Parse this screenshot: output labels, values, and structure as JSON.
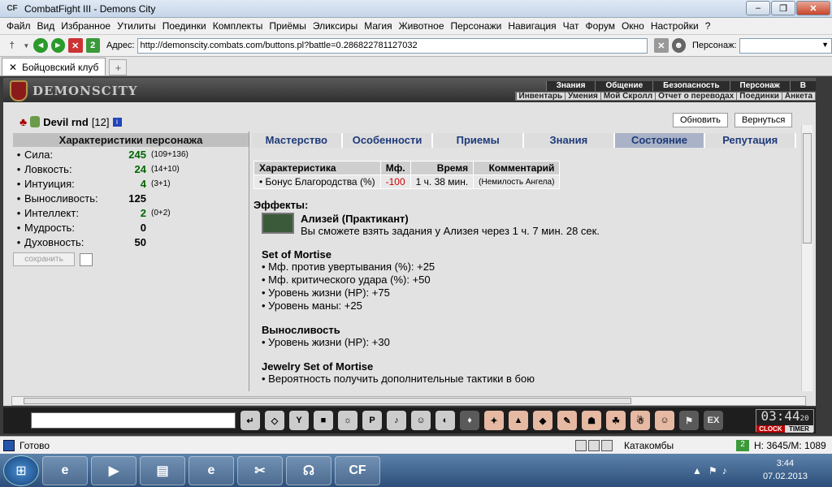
{
  "window": {
    "title": "CombatFight III - Demons City",
    "app_icon": "CF"
  },
  "menu": [
    "Файл",
    "Вид",
    "Избранное",
    "Утилиты",
    "Поединки",
    "Комплекты",
    "Приёмы",
    "Эликсиры",
    "Магия",
    "Животное",
    "Персонажи",
    "Навигация",
    "Чат",
    "Форум",
    "Окно",
    "Настройки",
    "?"
  ],
  "address": {
    "label": "Адрес:",
    "url": "http://demonscity.combats.com/buttons.pl?battle=0.286822781127032",
    "person_label": "Персонаж:"
  },
  "browser_tab": {
    "label": "Бойцовский клуб",
    "add": "+"
  },
  "game": {
    "logo": "DEMONSCITY",
    "top_nav": [
      "Знания",
      "Общение",
      "Безопасность",
      "Персонаж",
      "В"
    ],
    "sub_nav": [
      "Инвентарь",
      "Умения",
      "Мой Скролл",
      "Отчет о переводах",
      "Поединки",
      "Анкета"
    ],
    "character": {
      "name": "Devil rnd",
      "level": "[12]",
      "info": "i"
    },
    "buttons": {
      "refresh": "Обновить",
      "back": "Вернуться"
    },
    "stats_title": "Характеристики персонажа",
    "stats": [
      {
        "name": "Сила:",
        "value": "245",
        "extra": "(109+136)"
      },
      {
        "name": "Ловкость:",
        "value": "24",
        "extra": "(14+10)"
      },
      {
        "name": "Интуиция:",
        "value": "4",
        "extra": "(3+1)"
      },
      {
        "name": "Выносливость:",
        "value": "125",
        "extra": ""
      },
      {
        "name": "Интеллект:",
        "value": "2",
        "extra": "(0+2)"
      },
      {
        "name": "Мудрость:",
        "value": "0",
        "extra": ""
      },
      {
        "name": "Духовность:",
        "value": "50",
        "extra": ""
      }
    ],
    "save_label": "сохранить",
    "tabs": [
      "Мастерство",
      "Особенности",
      "Приемы",
      "Знания",
      "Состояние",
      "Репутация"
    ],
    "table": {
      "headers": [
        "Характеристика",
        "Мф.",
        "Время",
        "Комментарий"
      ],
      "row": [
        "• Бонус Благородства (%)",
        "-100",
        "1 ч. 38 мин.",
        "(Немилость Ангела)"
      ]
    },
    "effects_title": "Эффекты:",
    "alizey": {
      "title": "Ализей (Практикант)",
      "text": "Вы сможете взять задания у Ализея через 1 ч. 7 мин. 28 сек."
    },
    "sets": [
      {
        "title": "Set of Mortise",
        "lines": [
          "• Мф. против увертывания (%): +25",
          "• Мф. критического удара (%): +50",
          "• Уровень жизни (HP): +75",
          "• Уровень маны: +25"
        ]
      },
      {
        "title": "Выносливость",
        "lines": [
          "• Уровень жизни (HP): +30"
        ]
      },
      {
        "title": "Jewelry Set of Mortise",
        "lines": [
          "• Вероятность получить дополнительные тактики в бою"
        ]
      }
    ],
    "clock": {
      "time": "03:44",
      "seconds": "20",
      "clock_label": "CLOCK",
      "timer_label": "TIMER"
    }
  },
  "status": {
    "text": "Готово",
    "location": "Катакомбы",
    "hp": "H: 3645/M: 1089"
  },
  "taskbar": {
    "time": "3:44",
    "date": "07.02.2013"
  }
}
